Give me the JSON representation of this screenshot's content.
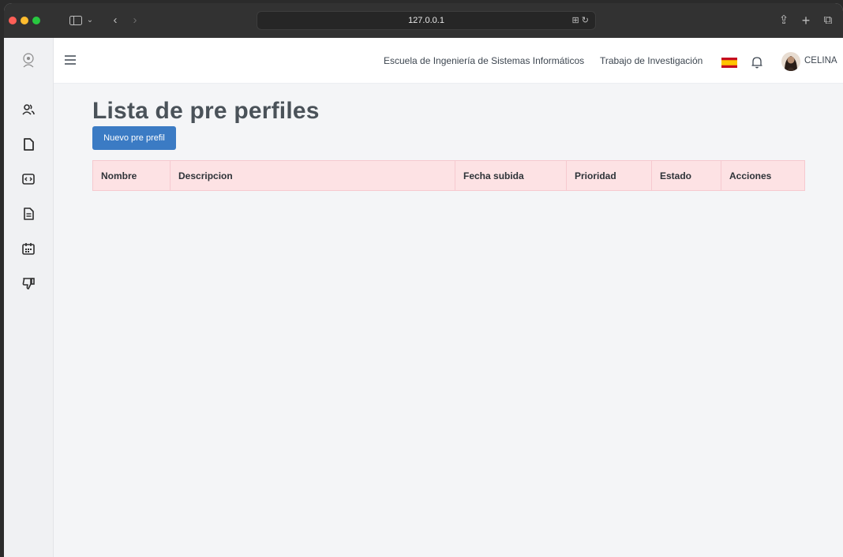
{
  "browser": {
    "url": "127.0.0.1",
    "colors": {
      "chrome": "#323232",
      "address_bar": "#262626"
    }
  },
  "navbar": {
    "links": [
      "Escuela de Ingeniería de Sistemas Informáticos",
      "Trabajo de Investigación"
    ],
    "user_name": "CELINA",
    "flag": "spain-flag-icon",
    "notification_icon": "bell-icon"
  },
  "sidebar": {
    "items": [
      {
        "icon": "users-icon"
      },
      {
        "icon": "document-icon"
      },
      {
        "icon": "code-icon"
      },
      {
        "icon": "file-text-icon"
      },
      {
        "icon": "calendar-icon"
      },
      {
        "icon": "thumbs-down-icon"
      }
    ]
  },
  "main": {
    "title": "Lista de pre perfiles",
    "new_button_label": "Nuevo pre prefil",
    "table": {
      "columns": [
        "Nombre",
        "Descripcion",
        "Fecha subida",
        "Prioridad",
        "Estado",
        "Acciones"
      ],
      "rows": []
    }
  },
  "colors": {
    "primary_button": "#3b7bc4",
    "table_header_bg": "#fde2e4",
    "page_bg": "#f4f5f7"
  }
}
